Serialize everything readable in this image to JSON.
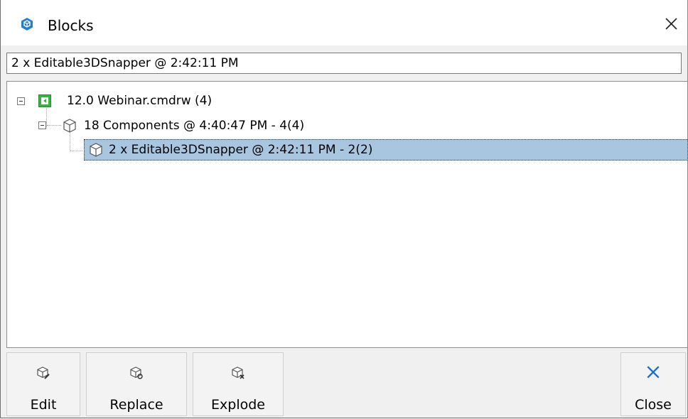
{
  "window": {
    "title": "Blocks",
    "icon": "blocks-app-icon",
    "close_icon": "close-x-icon"
  },
  "path_field": {
    "value": "2 x Editable3DSnapper @ 2:42:11 PM"
  },
  "tree": {
    "root": {
      "label": "12.0 Webinar.cmdrw (4)",
      "icon": "drawing-file-icon",
      "expanded": true
    },
    "child": {
      "label": "18 Components @ 4:40:47 PM - 4(4)",
      "icon": "block-cube-icon",
      "expanded": true
    },
    "grandchild": {
      "label": "2 x Editable3DSnapper @ 2:42:11 PM - 2(2)",
      "icon": "block-cube-icon",
      "selected": true
    }
  },
  "buttons": {
    "edit": {
      "label": "Edit",
      "icon": "edit-block-icon"
    },
    "replace": {
      "label": "Replace",
      "icon": "replace-block-icon"
    },
    "explode": {
      "label": "Explode",
      "icon": "explode-block-icon"
    },
    "close": {
      "label": "Close",
      "icon": "close-x-icon",
      "accent": "#1a6fd1"
    }
  },
  "colors": {
    "selection": "#a8c6df",
    "app_icon": "#1f7fd0",
    "file_icon": "#3cb043"
  }
}
